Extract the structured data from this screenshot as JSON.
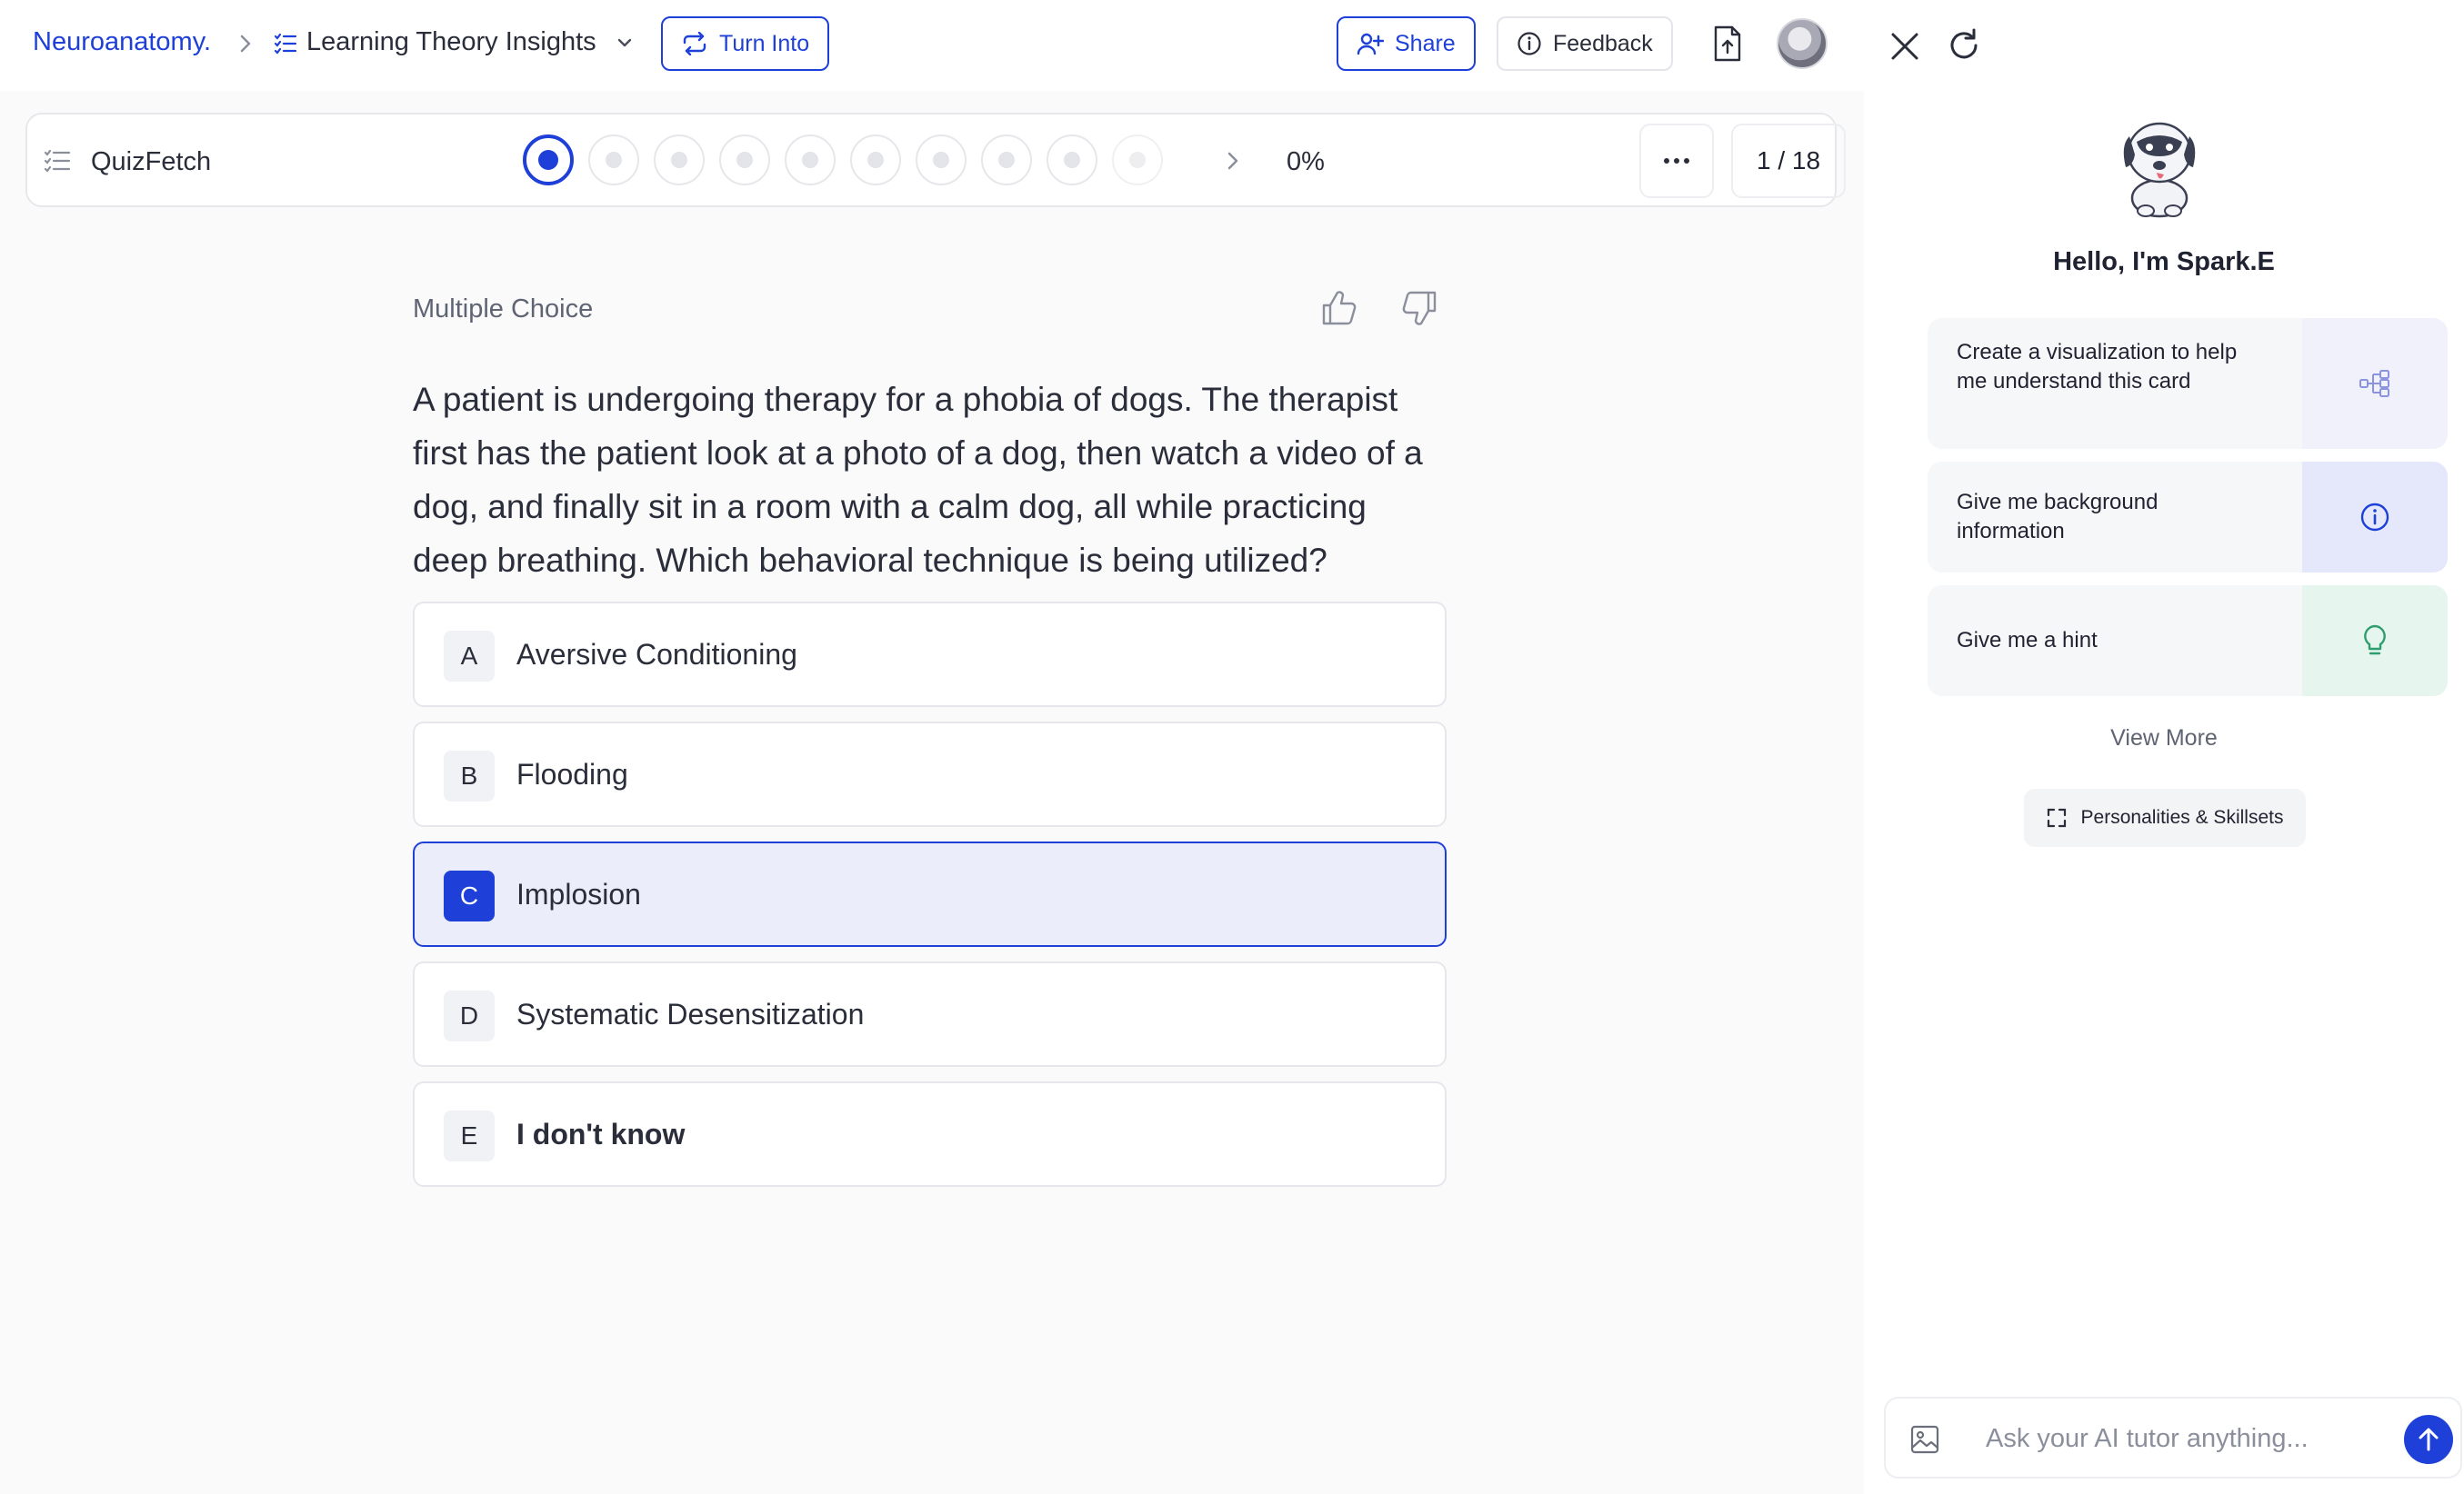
{
  "breadcrumb": {
    "root": "Neuroanatomy.",
    "title": "Learning Theory Insights"
  },
  "toolbar": {
    "turn_into": "Turn Into",
    "share": "Share",
    "feedback": "Feedback"
  },
  "quizbar": {
    "title": "QuizFetch",
    "progress": "0%",
    "progress_value": 0,
    "counter": "1 / 18",
    "visible_dots": 10,
    "active_dot": 0
  },
  "question": {
    "type": "Multiple Choice",
    "text": "A patient is undergoing therapy for a phobia of dogs. The therapist first has the patient look at a photo of a dog, then watch a video of a dog, and finally sit in a room with a calm dog, all while practicing deep breathing. Which behavioral technique is being utilized?",
    "options": [
      {
        "letter": "A",
        "label": "Aversive Conditioning"
      },
      {
        "letter": "B",
        "label": "Flooding"
      },
      {
        "letter": "C",
        "label": "Implosion"
      },
      {
        "letter": "D",
        "label": "Systematic Desensitization"
      },
      {
        "letter": "E",
        "label": "I don't know"
      }
    ],
    "selected": "C"
  },
  "assistant": {
    "greeting": "Hello, I'm Spark.E",
    "suggestions": [
      {
        "label": "Create a visualization to help me understand this card",
        "icon": "diagram-icon",
        "color": "#f0f1fb"
      },
      {
        "label": "Give me background information",
        "icon": "info-icon",
        "color": "#e4e8fa"
      },
      {
        "label": "Give me a hint",
        "icon": "lightbulb-icon",
        "color": "#e6f5ee"
      }
    ],
    "view_more": "View More",
    "personalities": "Personalities & Skillsets",
    "input_placeholder": "Ask your AI tutor anything..."
  },
  "colors": {
    "accent": "#1e40d8",
    "selected_bg": "#ebeefa"
  }
}
